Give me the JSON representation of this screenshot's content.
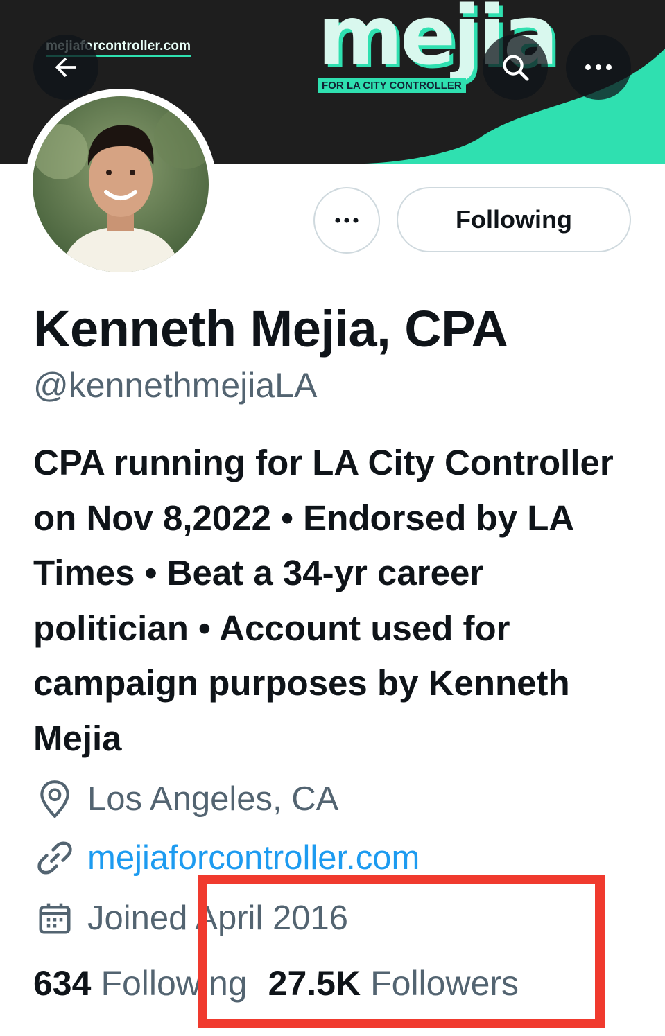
{
  "banner": {
    "site_url": "mejiaforcontroller.com",
    "logo_text": "mejia",
    "logo_tagline": "FOR LA CITY CONTROLLER",
    "colors": {
      "accent": "#2fe0b0",
      "dark": "#1e1e1e"
    }
  },
  "nav": {
    "back_icon": "arrow-left-icon",
    "search_icon": "search-icon",
    "more_icon": "more-horizontal-icon"
  },
  "profile": {
    "name": "Kenneth Mejia, CPA",
    "handle": "@kennethmejiaLA",
    "bio": "CPA running for LA City Controller on Nov 8,2022 • Endorsed by LA Times • Beat a 34-yr career politician • Account used for campaign purposes by Kenneth Mejia",
    "location": "Los Angeles, CA",
    "website": "mejiaforcontroller.com",
    "joined": "Joined April 2016"
  },
  "actions": {
    "more_label": "•••",
    "follow_state_label": "Following"
  },
  "stats": {
    "following_count": "634",
    "following_label": "Following",
    "followers_count": "27.5K",
    "followers_label": "Followers"
  },
  "annotation": {
    "color": "#f03a2e"
  },
  "colors": {
    "link": "#1d9bf0",
    "secondary_text": "#536471",
    "primary_text": "#0f1419"
  }
}
